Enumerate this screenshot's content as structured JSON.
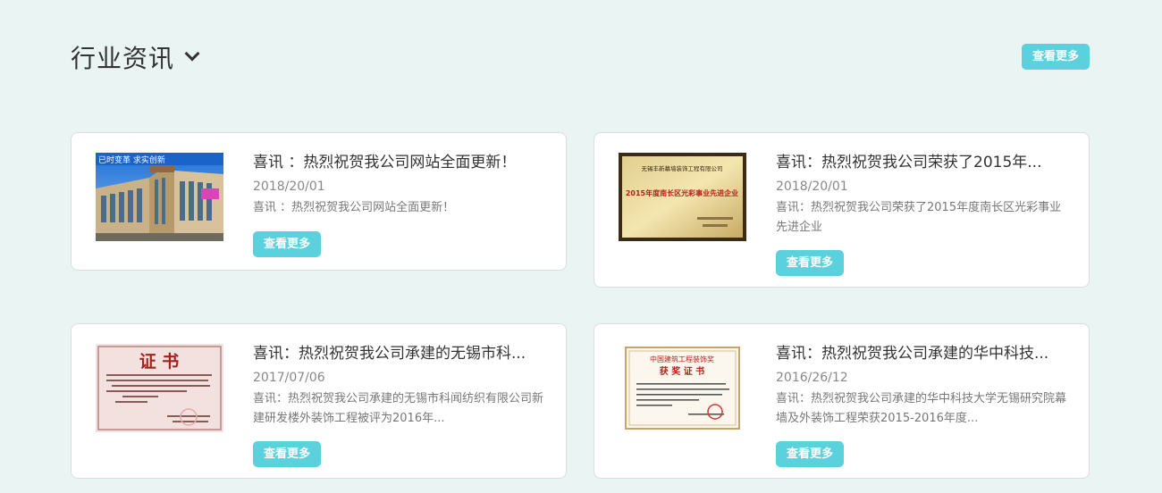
{
  "header": {
    "title": "行业资讯",
    "more_label": "查看更多"
  },
  "thumbs": {
    "building_banner": "已时变革 求实创新",
    "award_company": "无锡丰新幕墙装饰工程有限公司",
    "award_title": "2015年度南长区光彩事业先进企业",
    "cert1_title": "证 书",
    "cert2_org": "中国建筑工程装饰奖",
    "cert2_title": "获 奖 证 书"
  },
  "news": [
    {
      "title": "喜讯 ：热烈祝贺我公司网站全面更新！",
      "date": "2018/20/01",
      "desc": "喜讯 ：热烈祝贺我公司网站全面更新！",
      "button": "查看更多"
    },
    {
      "title": "喜讯：热烈祝贺我公司荣获了2015年...",
      "date": "2018/20/01",
      "desc": "喜讯：热烈祝贺我公司荣获了2015年度南长区光彩事业先进企业",
      "button": "查看更多"
    },
    {
      "title": "喜讯：热烈祝贺我公司承建的无锡市科...",
      "date": "2017/07/06",
      "desc": "喜讯：热烈祝贺我公司承建的无锡市科闻纺织有限公司新建研发楼外装饰工程被评为2016年...",
      "button": "查看更多"
    },
    {
      "title": "喜讯：热烈祝贺我公司承建的华中科技...",
      "date": "2016/26/12",
      "desc": "喜讯：热烈祝贺我公司承建的华中科技大学无锡研究院幕墙及外装饰工程荣获2015-2016年度...",
      "button": "查看更多"
    }
  ]
}
